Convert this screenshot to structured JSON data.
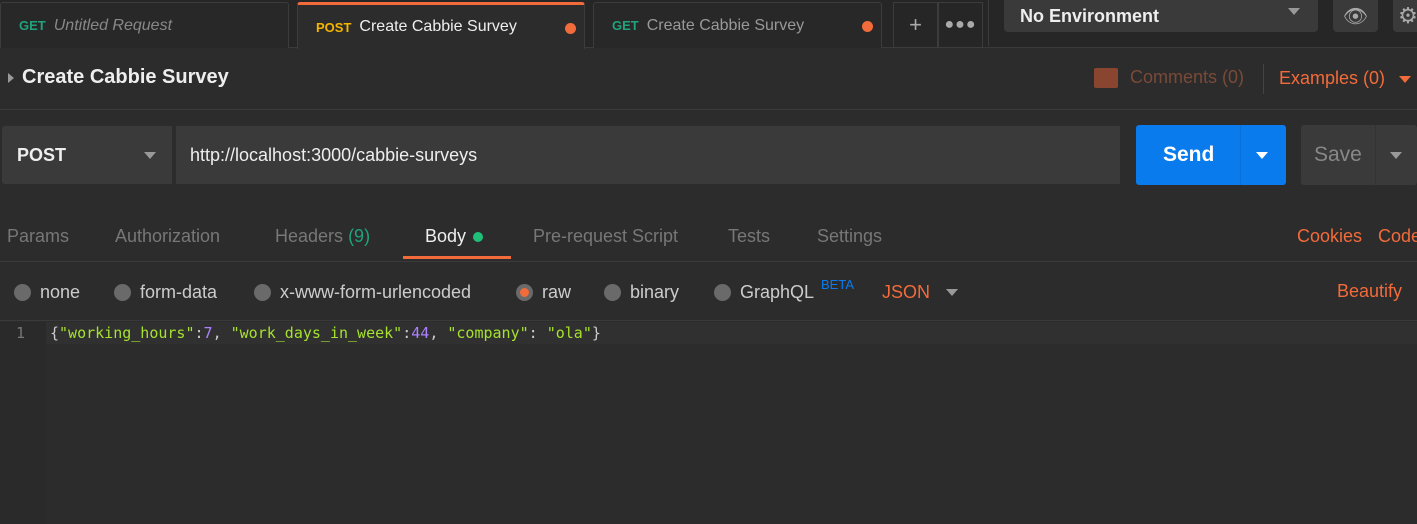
{
  "tabs": [
    {
      "method": "GET",
      "label": "Untitled Request",
      "active": false,
      "unsaved": false
    },
    {
      "method": "POST",
      "label": "Create Cabbie Survey",
      "active": true,
      "unsaved": true
    },
    {
      "method": "GET",
      "label": "Create Cabbie Survey",
      "active": false,
      "unsaved": true
    }
  ],
  "tabbar": {
    "new_tab_icon": "plus-icon",
    "more_icon": "ellipsis-icon"
  },
  "environment": {
    "selected": "No Environment"
  },
  "request": {
    "title": "Create Cabbie Survey",
    "comments": "Comments (0)",
    "examples": "Examples (0)",
    "method": "POST",
    "url": "http://localhost:3000/cabbie-surveys",
    "send": "Send",
    "save": "Save"
  },
  "request_tabs": [
    {
      "label": "Params"
    },
    {
      "label": "Authorization"
    },
    {
      "label": "Headers",
      "count": "(9)"
    },
    {
      "label": "Body",
      "active": true
    },
    {
      "label": "Pre-request Script"
    },
    {
      "label": "Tests"
    },
    {
      "label": "Settings"
    }
  ],
  "right_links": {
    "cookies": "Cookies",
    "code": "Code"
  },
  "body_types": [
    "none",
    "form-data",
    "x-www-form-urlencoded",
    "raw",
    "binary",
    "GraphQL"
  ],
  "body_selected": "raw",
  "beta": "BETA",
  "format": "JSON",
  "beautify": "Beautify",
  "editor": {
    "line_number": "1",
    "tokens": [
      {
        "t": "{",
        "c": "#ccc"
      },
      {
        "t": "\"working_hours\"",
        "c": "#a6e22e"
      },
      {
        "t": ":",
        "c": "#ccc"
      },
      {
        "t": "7",
        "c": "#ae81ff"
      },
      {
        "t": ", ",
        "c": "#ccc"
      },
      {
        "t": "\"work_days_in_week\"",
        "c": "#a6e22e"
      },
      {
        "t": ":",
        "c": "#ccc"
      },
      {
        "t": "44",
        "c": "#ae81ff"
      },
      {
        "t": ", ",
        "c": "#ccc"
      },
      {
        "t": "\"company\"",
        "c": "#a6e22e"
      },
      {
        "t": ": ",
        "c": "#ccc"
      },
      {
        "t": "\"ola\"",
        "c": "#a6e22e"
      },
      {
        "t": "}",
        "c": "#ccc"
      }
    ]
  },
  "colors": {
    "accent": "#f26b3a",
    "send": "#097bed",
    "get": "#1fa37a",
    "post": "#f4b400"
  }
}
